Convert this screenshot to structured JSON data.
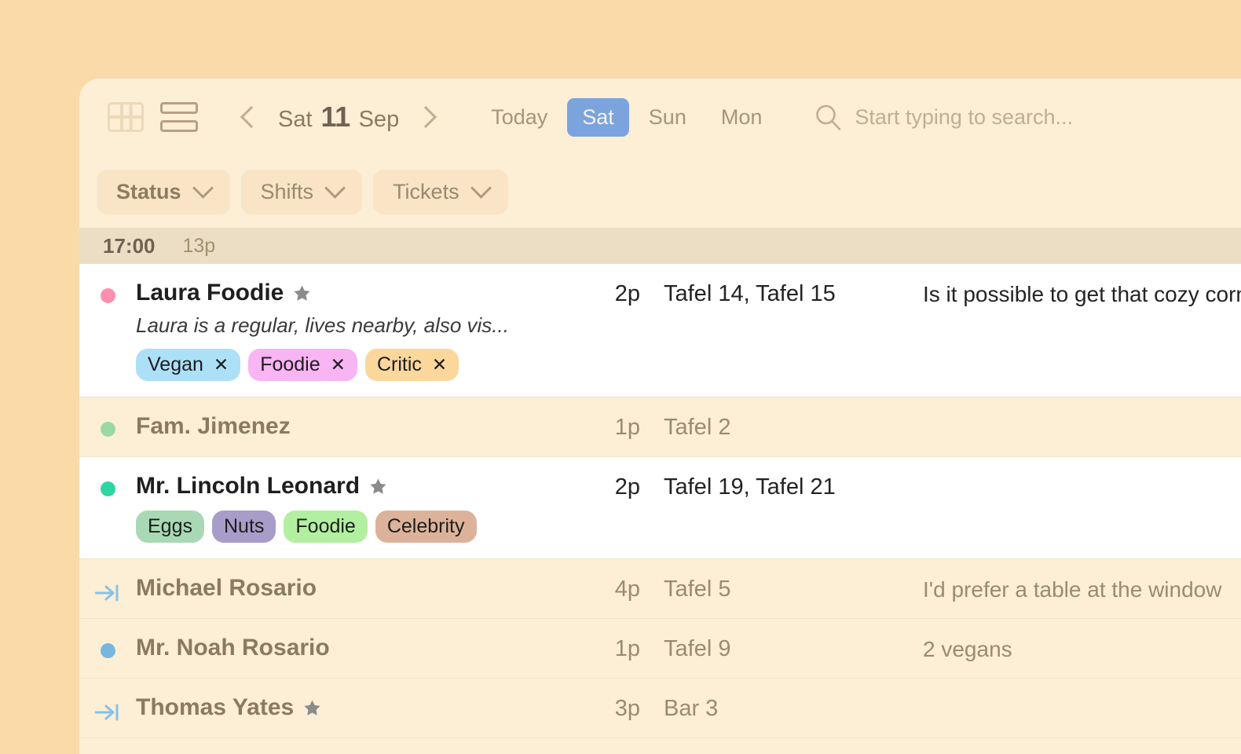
{
  "toolbar": {
    "grid_view_icon": "grid-view-icon",
    "list_view_icon": "list-view-icon",
    "prev_icon": "chevron-left-icon",
    "next_icon": "chevron-right-icon",
    "date": {
      "weekday": "Sat",
      "day": "11",
      "month": "Sep"
    },
    "today_label": "Today",
    "day_tabs": [
      {
        "label": "Sat",
        "active": true
      },
      {
        "label": "Sun",
        "active": false
      },
      {
        "label": "Mon",
        "active": false
      }
    ],
    "search": {
      "icon": "search-icon",
      "value": "",
      "placeholder": "Start typing to search..."
    },
    "active_tab_color": "#7ba4de"
  },
  "filters": [
    {
      "label": "Status",
      "strong": true
    },
    {
      "label": "Shifts",
      "strong": false
    },
    {
      "label": "Tickets",
      "strong": false
    }
  ],
  "time_group": {
    "time": "17:00",
    "pax_total": "13p"
  },
  "reservations": [
    {
      "status": {
        "type": "dot",
        "color": "#fd8fae"
      },
      "name": "Laura Foodie",
      "vip": true,
      "note_line": "Laura is a regular, lives nearby, also vis...",
      "tags": [
        {
          "label": "Vegan",
          "color": "#ace0f7",
          "removable": true
        },
        {
          "label": "Foodie",
          "color": "#f8b4f3",
          "removable": true
        },
        {
          "label": "Critic",
          "color": "#fbd79c",
          "removable": true
        }
      ],
      "pax": "2p",
      "tables": "Tafel 14, Tafel 15",
      "comment": "Is it possible to get that cozy corner tab",
      "expanded": true
    },
    {
      "status": {
        "type": "dot",
        "color": "#9ad9a4"
      },
      "name": "Fam. Jimenez",
      "vip": false,
      "note_line": "",
      "tags": [],
      "pax": "1p",
      "tables": "Tafel 2",
      "comment": "",
      "expanded": false
    },
    {
      "status": {
        "type": "dot",
        "color": "#2fd4a4"
      },
      "name": "Mr. Lincoln Leonard",
      "vip": true,
      "note_line": "",
      "tags": [
        {
          "label": "Eggs",
          "color": "#a8d9b4",
          "removable": false
        },
        {
          "label": "Nuts",
          "color": "#a89cc8",
          "removable": false
        },
        {
          "label": "Foodie",
          "color": "#b3efa0",
          "removable": false
        },
        {
          "label": "Celebrity",
          "color": "#dcb39a",
          "removable": false
        }
      ],
      "pax": "2p",
      "tables": "Tafel 19, Tafel 21",
      "comment": "",
      "expanded": true
    },
    {
      "status": {
        "type": "arrive",
        "color": "#86c2e6"
      },
      "name": "Michael Rosario",
      "vip": false,
      "note_line": "",
      "tags": [],
      "pax": "4p",
      "tables": "Tafel 5",
      "comment": "I'd prefer a table at the window",
      "expanded": false
    },
    {
      "status": {
        "type": "dot",
        "color": "#77b6dd"
      },
      "name": "Mr. Noah Rosario",
      "vip": false,
      "note_line": "",
      "tags": [],
      "pax": "1p",
      "tables": "Tafel 9",
      "comment": "2 vegans",
      "expanded": false
    },
    {
      "status": {
        "type": "arrive",
        "color": "#86c2e6"
      },
      "name": "Thomas Yates",
      "vip": true,
      "note_line": "",
      "tags": [],
      "pax": "3p",
      "tables": "Bar 3",
      "comment": "",
      "expanded": false
    }
  ],
  "colors": {
    "page_background": "#fadaa8",
    "panel_background": "#fdeed6",
    "time_band": "#ebdec4",
    "expanded_row": "#ffffff"
  }
}
